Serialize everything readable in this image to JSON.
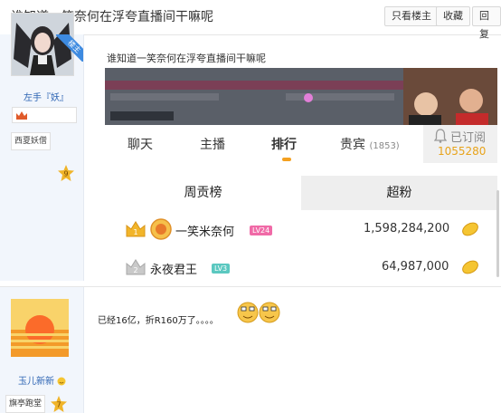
{
  "thread": {
    "title": "谁知道一笑奈何在浮夸直播间干嘛呢",
    "buttons": {
      "only_op": "只看楼主",
      "favorite": "收藏",
      "reply": "回复"
    }
  },
  "post1": {
    "op_badge": "楼主",
    "username": "左手『妖』",
    "level_name": "西夏妖僧",
    "level_num": "9",
    "content_title": "谁知道一笑奈何在浮夸直播间干嘛呢",
    "screenshot": {
      "tabs": [
        {
          "label": "聊天"
        },
        {
          "label": "主播"
        },
        {
          "label": "排行"
        },
        {
          "label": "贵宾",
          "count": "(1853)"
        }
      ],
      "subscribed_label": "已订阅",
      "subscribed_count": "1055280",
      "rank_tabs": {
        "weekly": "周贡榜",
        "super_fan": "超粉"
      },
      "ranks": [
        {
          "rank": "1",
          "name": "一笑米奈何",
          "level": "LV24",
          "value": "1,598,284,200",
          "level_color": "#f06aa7"
        },
        {
          "rank": "2",
          "name": "永夜君王",
          "level": "LV3",
          "value": "64,987,000",
          "level_color": "#5bc8c0"
        }
      ]
    }
  },
  "post2": {
    "username": "玉儿新新",
    "level_name": "旗亭跑堂",
    "level_num": "7",
    "reply_text": "已经16亿，折R160万了。。。。"
  }
}
